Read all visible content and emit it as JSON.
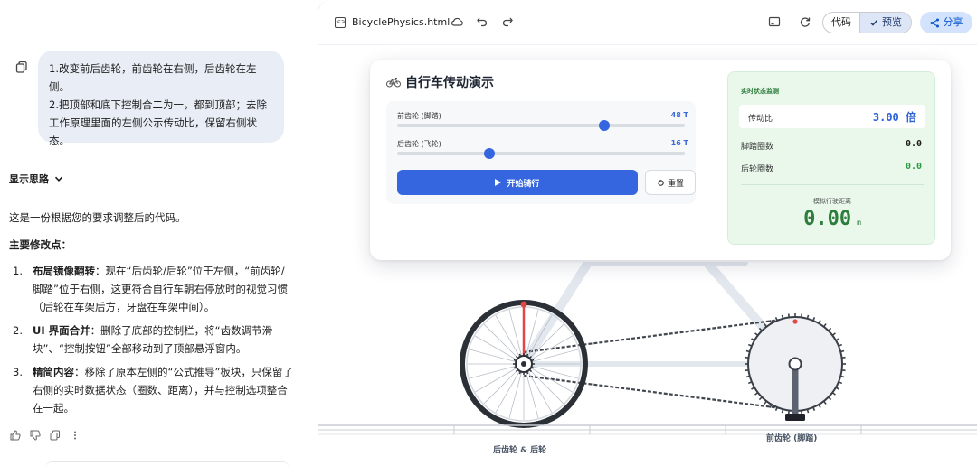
{
  "chat": {
    "user_message": {
      "line1": "1.改变前后齿轮，前齿轮在右侧，后齿轮在左侧。",
      "line2": "2.把顶部和底下控制合二为一，都到顶部；去除工作原理里面的左侧公示传动比，保留右侧状态。"
    },
    "thinking_toggle": "显示思路",
    "intro": "这是一份根据您的要求调整后的代码。",
    "changes_heading": "主要修改点：",
    "changes": [
      {
        "num": "1.",
        "title": "布局镜像翻转",
        "text": "：现在“后齿轮/后轮”位于左侧，“前齿轮/脚踏”位于右侧，这更符合自行车朝右停放时的视觉习惯（后轮在车架后方，牙盘在车架中间）。"
      },
      {
        "num": "2.",
        "title": "UI 界面合并",
        "text": "：删除了底部的控制栏，将“齿数调节滑块”、“控制按钮”全部移动到了顶部悬浮窗内。"
      },
      {
        "num": "3.",
        "title": "精简内容",
        "text": "：移除了原本左侧的“公式推导”板块，只保留了右侧的实时数据状态（圈数、距离），并与控制选项整合在一起。"
      }
    ]
  },
  "canvas": {
    "file_name": "BicyclePhysics.html",
    "toggle_code": "代码",
    "toggle_preview": "预览",
    "share": "分享"
  },
  "app": {
    "title": "自行车传动演示",
    "front_label": "前齿轮 (脚踏)",
    "front_value": "48 T",
    "front_level": 0.72,
    "rear_label": "后齿轮 (飞轮)",
    "rear_value": "16 T",
    "rear_level": 0.32,
    "start_button": "开始骑行",
    "reset_button": "重置",
    "status_title": "实时状态监测",
    "ratio_label": "传动比",
    "ratio_value": "3.00 倍",
    "pedal_label": "脚踏圈数",
    "pedal_value": "0.0",
    "wheel_label": "后轮圈数",
    "wheel_value": "0.0",
    "distance_label": "模拟行驶距离",
    "distance_value": "0.00",
    "distance_unit": "m",
    "rear_caption": "后齿轮 & 后轮",
    "front_caption": "前齿轮 (脚踏)"
  },
  "colors": {
    "accent": "#3566df",
    "status_green": "#2e7d3d",
    "ratio_blue": "#2b62d6",
    "spoke_red": "#e04848"
  }
}
